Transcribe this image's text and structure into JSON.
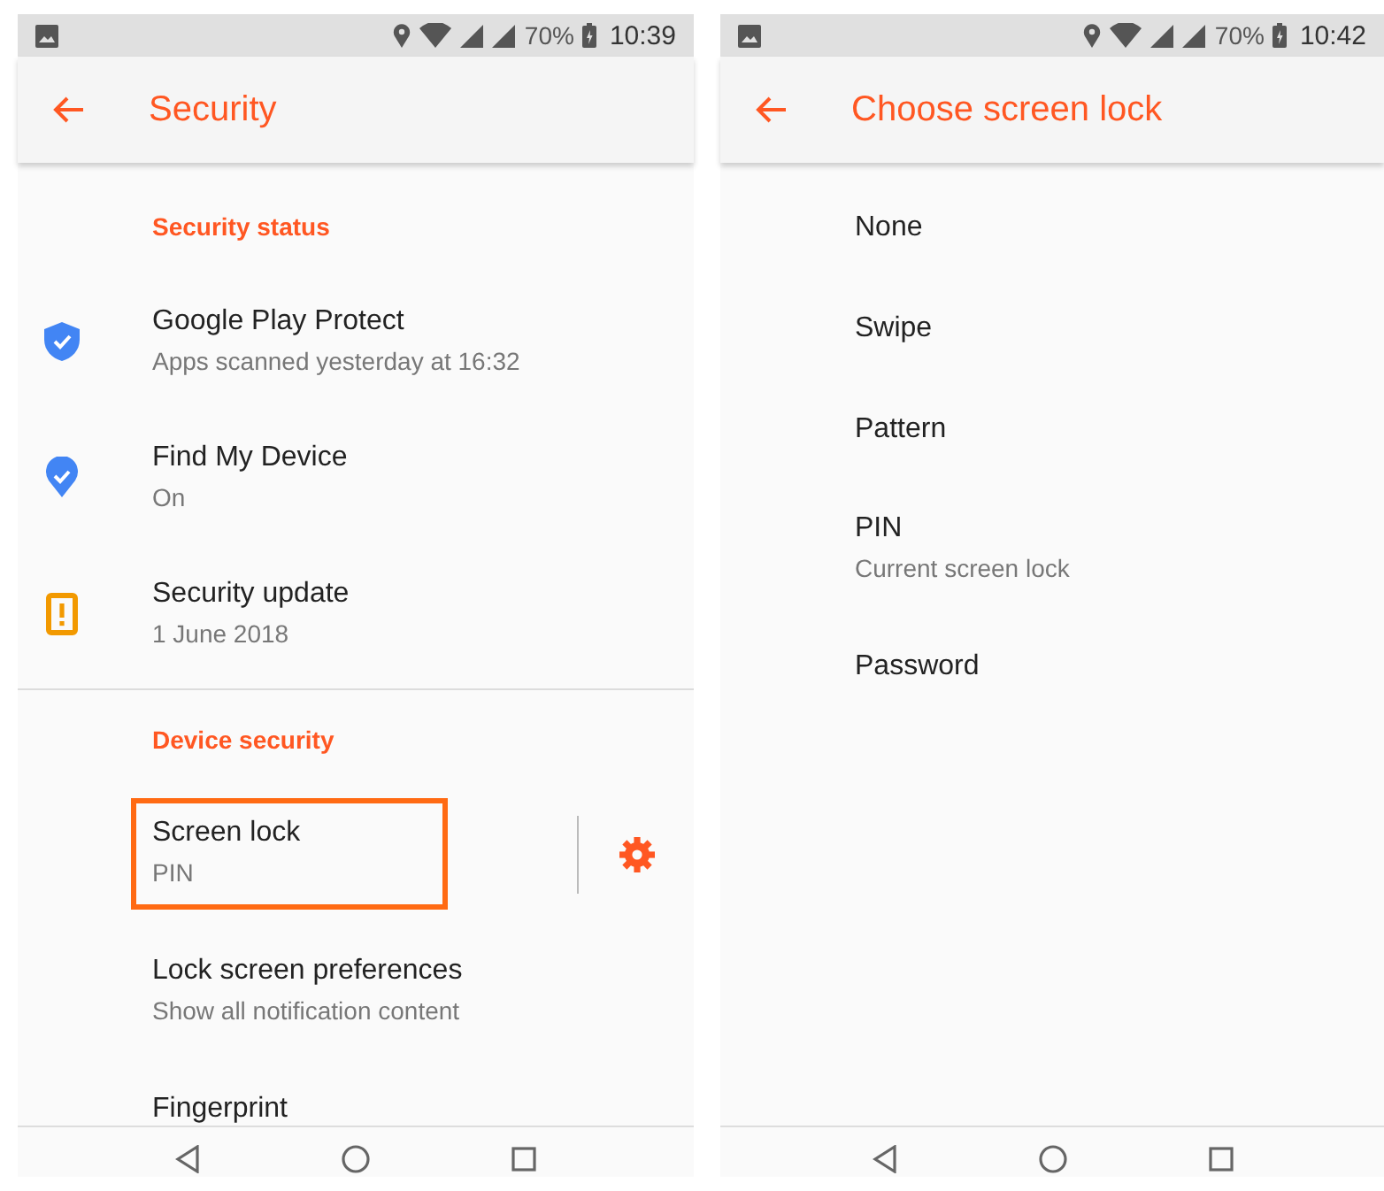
{
  "screens": [
    {
      "status_bar": {
        "battery": "70%",
        "time": "10:39"
      },
      "app_bar": {
        "title": "Security"
      },
      "sections": [
        {
          "header": "Security status",
          "items": [
            {
              "kind": "shield",
              "title": "Google Play Protect",
              "subtitle": "Apps scanned yesterday at 16:32",
              "highlighted": false,
              "settings": false
            },
            {
              "kind": "pin",
              "title": "Find My Device",
              "subtitle": "On",
              "highlighted": false,
              "settings": false
            },
            {
              "kind": "alert",
              "title": "Security update",
              "subtitle": "1 June 2018",
              "highlighted": false,
              "settings": false
            }
          ]
        },
        {
          "header": "Device security",
          "items": [
            {
              "kind": "plain",
              "title": "Screen lock",
              "subtitle": "PIN",
              "highlighted": true,
              "settings": true
            },
            {
              "kind": "plain",
              "title": "Lock screen preferences",
              "subtitle": "Show all notification content",
              "highlighted": false,
              "settings": false
            },
            {
              "kind": "plain",
              "title": "Fingerprint",
              "highlighted": false,
              "settings": false
            }
          ]
        }
      ]
    },
    {
      "status_bar": {
        "battery": "70%",
        "time": "10:42"
      },
      "app_bar": {
        "title": "Choose screen lock"
      },
      "sections": [
        {
          "items": [
            {
              "kind": "plain",
              "title": "None",
              "highlighted": false,
              "settings": false
            },
            {
              "kind": "plain",
              "title": "Swipe",
              "highlighted": false,
              "settings": false
            },
            {
              "kind": "plain",
              "title": "Pattern",
              "highlighted": false,
              "settings": false
            },
            {
              "kind": "plain",
              "title": "PIN",
              "subtitle": "Current screen lock",
              "highlighted": false,
              "settings": false
            },
            {
              "kind": "plain",
              "title": "Password",
              "highlighted": false,
              "settings": false
            }
          ]
        }
      ]
    }
  ]
}
